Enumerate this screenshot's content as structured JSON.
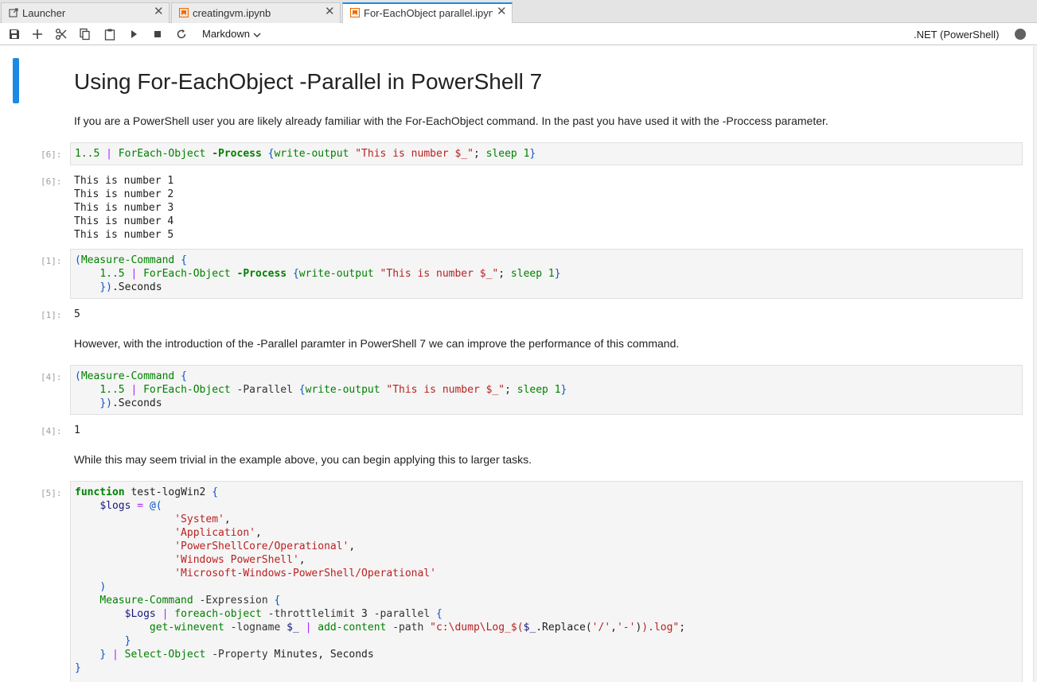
{
  "tabs": [
    {
      "label": "Launcher",
      "icon": "launcher-icon"
    },
    {
      "label": "creatingvm.ipynb",
      "icon": "notebook-icon"
    },
    {
      "label": "For-EachObject parallel.ipynb",
      "icon": "notebook-icon",
      "active": true
    }
  ],
  "toolbar": {
    "cell_type": "Markdown",
    "kernel": ".NET (PowerShell)",
    "buttons": [
      "save-icon",
      "add-cell-icon",
      "cut-icon",
      "copy-icon",
      "paste-icon",
      "run-icon",
      "stop-icon",
      "restart-icon"
    ]
  },
  "colors": {
    "accent": "#1e88e5",
    "code_bg": "#f5f5f5",
    "kernel_idle": "#616161"
  },
  "notebook": {
    "title": "Using For-EachObject -Parallel in PowerShell 7",
    "intro": "If you are a PowerShell user you are likely already familiar with the For-EachObject command. In the past you have used it with the -Proccess parameter.",
    "cell1": {
      "prompt": "[6]:",
      "out_prompt": "[6]:",
      "output": [
        "This is number 1",
        "This is number 2",
        "This is number 3",
        "This is number 4",
        "This is number 5"
      ]
    },
    "cell2": {
      "prompt": "[1]:",
      "out_prompt": "[1]:",
      "output": "5"
    },
    "para2": "However, with the introduction of the -Parallel paramter in PowerShell 7 we can improve the performance of this command.",
    "cell3": {
      "prompt": "[4]:",
      "out_prompt": "[4]:",
      "output": "1"
    },
    "para3": "While this may seem trivial in the example above, you can begin applying this to larger tasks.",
    "cell4": {
      "prompt": "[5]:"
    }
  }
}
